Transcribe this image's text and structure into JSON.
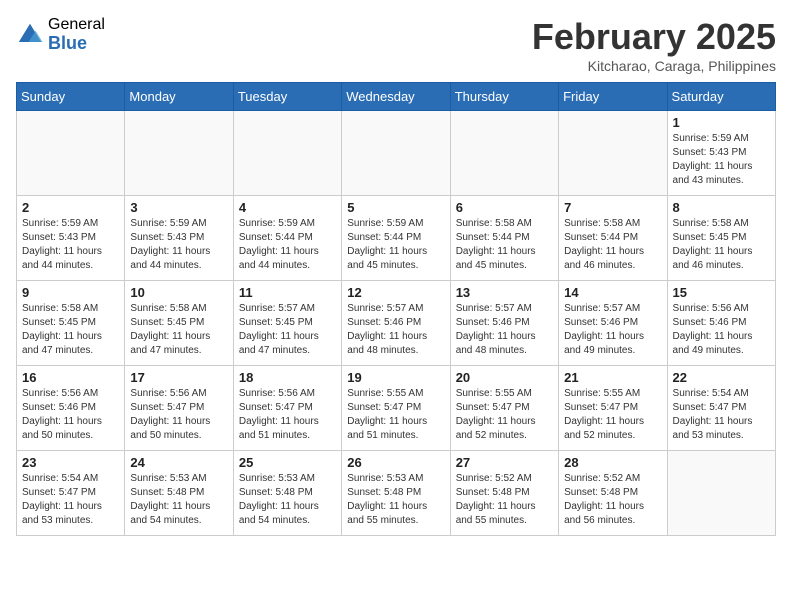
{
  "header": {
    "logo_general": "General",
    "logo_blue": "Blue",
    "month_title": "February 2025",
    "location": "Kitcharao, Caraga, Philippines"
  },
  "days_of_week": [
    "Sunday",
    "Monday",
    "Tuesday",
    "Wednesday",
    "Thursday",
    "Friday",
    "Saturday"
  ],
  "weeks": [
    [
      {
        "day": "",
        "info": ""
      },
      {
        "day": "",
        "info": ""
      },
      {
        "day": "",
        "info": ""
      },
      {
        "day": "",
        "info": ""
      },
      {
        "day": "",
        "info": ""
      },
      {
        "day": "",
        "info": ""
      },
      {
        "day": "1",
        "info": "Sunrise: 5:59 AM\nSunset: 5:43 PM\nDaylight: 11 hours\nand 43 minutes."
      }
    ],
    [
      {
        "day": "2",
        "info": "Sunrise: 5:59 AM\nSunset: 5:43 PM\nDaylight: 11 hours\nand 44 minutes."
      },
      {
        "day": "3",
        "info": "Sunrise: 5:59 AM\nSunset: 5:43 PM\nDaylight: 11 hours\nand 44 minutes."
      },
      {
        "day": "4",
        "info": "Sunrise: 5:59 AM\nSunset: 5:44 PM\nDaylight: 11 hours\nand 44 minutes."
      },
      {
        "day": "5",
        "info": "Sunrise: 5:59 AM\nSunset: 5:44 PM\nDaylight: 11 hours\nand 45 minutes."
      },
      {
        "day": "6",
        "info": "Sunrise: 5:58 AM\nSunset: 5:44 PM\nDaylight: 11 hours\nand 45 minutes."
      },
      {
        "day": "7",
        "info": "Sunrise: 5:58 AM\nSunset: 5:44 PM\nDaylight: 11 hours\nand 46 minutes."
      },
      {
        "day": "8",
        "info": "Sunrise: 5:58 AM\nSunset: 5:45 PM\nDaylight: 11 hours\nand 46 minutes."
      }
    ],
    [
      {
        "day": "9",
        "info": "Sunrise: 5:58 AM\nSunset: 5:45 PM\nDaylight: 11 hours\nand 47 minutes."
      },
      {
        "day": "10",
        "info": "Sunrise: 5:58 AM\nSunset: 5:45 PM\nDaylight: 11 hours\nand 47 minutes."
      },
      {
        "day": "11",
        "info": "Sunrise: 5:57 AM\nSunset: 5:45 PM\nDaylight: 11 hours\nand 47 minutes."
      },
      {
        "day": "12",
        "info": "Sunrise: 5:57 AM\nSunset: 5:46 PM\nDaylight: 11 hours\nand 48 minutes."
      },
      {
        "day": "13",
        "info": "Sunrise: 5:57 AM\nSunset: 5:46 PM\nDaylight: 11 hours\nand 48 minutes."
      },
      {
        "day": "14",
        "info": "Sunrise: 5:57 AM\nSunset: 5:46 PM\nDaylight: 11 hours\nand 49 minutes."
      },
      {
        "day": "15",
        "info": "Sunrise: 5:56 AM\nSunset: 5:46 PM\nDaylight: 11 hours\nand 49 minutes."
      }
    ],
    [
      {
        "day": "16",
        "info": "Sunrise: 5:56 AM\nSunset: 5:46 PM\nDaylight: 11 hours\nand 50 minutes."
      },
      {
        "day": "17",
        "info": "Sunrise: 5:56 AM\nSunset: 5:47 PM\nDaylight: 11 hours\nand 50 minutes."
      },
      {
        "day": "18",
        "info": "Sunrise: 5:56 AM\nSunset: 5:47 PM\nDaylight: 11 hours\nand 51 minutes."
      },
      {
        "day": "19",
        "info": "Sunrise: 5:55 AM\nSunset: 5:47 PM\nDaylight: 11 hours\nand 51 minutes."
      },
      {
        "day": "20",
        "info": "Sunrise: 5:55 AM\nSunset: 5:47 PM\nDaylight: 11 hours\nand 52 minutes."
      },
      {
        "day": "21",
        "info": "Sunrise: 5:55 AM\nSunset: 5:47 PM\nDaylight: 11 hours\nand 52 minutes."
      },
      {
        "day": "22",
        "info": "Sunrise: 5:54 AM\nSunset: 5:47 PM\nDaylight: 11 hours\nand 53 minutes."
      }
    ],
    [
      {
        "day": "23",
        "info": "Sunrise: 5:54 AM\nSunset: 5:47 PM\nDaylight: 11 hours\nand 53 minutes."
      },
      {
        "day": "24",
        "info": "Sunrise: 5:53 AM\nSunset: 5:48 PM\nDaylight: 11 hours\nand 54 minutes."
      },
      {
        "day": "25",
        "info": "Sunrise: 5:53 AM\nSunset: 5:48 PM\nDaylight: 11 hours\nand 54 minutes."
      },
      {
        "day": "26",
        "info": "Sunrise: 5:53 AM\nSunset: 5:48 PM\nDaylight: 11 hours\nand 55 minutes."
      },
      {
        "day": "27",
        "info": "Sunrise: 5:52 AM\nSunset: 5:48 PM\nDaylight: 11 hours\nand 55 minutes."
      },
      {
        "day": "28",
        "info": "Sunrise: 5:52 AM\nSunset: 5:48 PM\nDaylight: 11 hours\nand 56 minutes."
      },
      {
        "day": "",
        "info": ""
      }
    ]
  ]
}
